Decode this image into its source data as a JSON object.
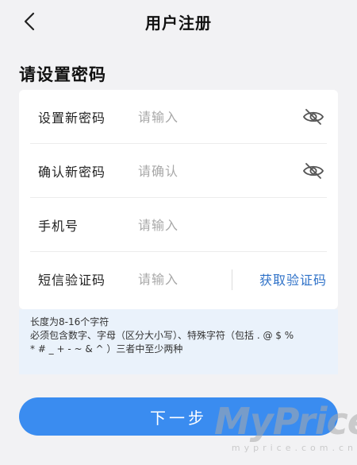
{
  "header": {
    "title": "用户注册",
    "back_icon": "chevron-left-icon"
  },
  "section": {
    "title": "请设置密码"
  },
  "form": {
    "new_password": {
      "label": "设置新密码",
      "placeholder": "请输入",
      "value": "",
      "toggle_icon": "eye-off-icon"
    },
    "confirm_password": {
      "label": "确认新密码",
      "placeholder": "请确认",
      "value": "",
      "toggle_icon": "eye-off-icon"
    },
    "phone": {
      "label": "手机号",
      "placeholder": "请输入",
      "value": ""
    },
    "sms_code": {
      "label": "短信验证码",
      "placeholder": "请输入",
      "value": "",
      "action_label": "获取验证码"
    }
  },
  "hint": {
    "lines": [
      "长度为8-16个字符",
      "必须包含数字、字母（区分大小写）、特殊字符（包括 . @ $ %",
      "* # _ + - ~ & ^ ）三者中至少两种"
    ]
  },
  "next_button": {
    "label": "下一步"
  },
  "watermark": {
    "brand": "MyPrice",
    "url": "myprice.com.cn"
  },
  "colors": {
    "accent": "#3a8cf0",
    "link": "#2f72c8",
    "background": "#f2f2f4",
    "hint_bg": "#eaf2fb"
  }
}
